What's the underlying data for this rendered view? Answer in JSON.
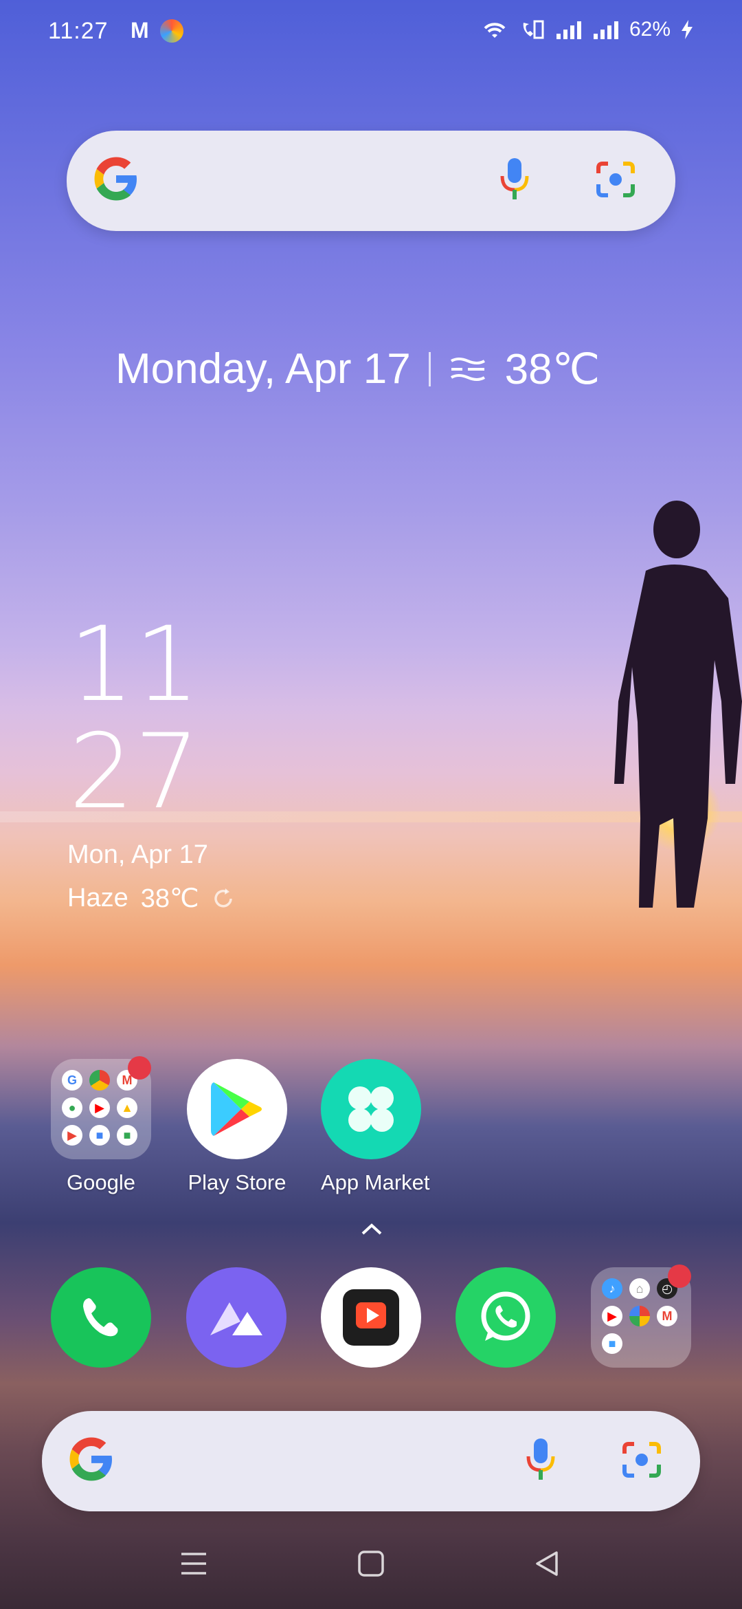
{
  "status_bar": {
    "time": "11:27",
    "battery": "62%",
    "icons": [
      "gmail-icon",
      "opera-icon",
      "wifi-icon",
      "volte-icon",
      "signal-icon",
      "signal-icon",
      "charging-icon"
    ]
  },
  "top_search": {
    "icons": [
      "google-logo",
      "microphone-icon",
      "lens-icon"
    ]
  },
  "date_widget": {
    "date": "Monday, Apr 17",
    "temp": "38℃",
    "weather_icon": "haze-icon"
  },
  "clock_widget": {
    "hour": "11",
    "minute": "27",
    "date": "Mon, Apr 17",
    "condition": "Haze",
    "temp": "38℃"
  },
  "apps": [
    {
      "label": "Google",
      "type": "folder"
    },
    {
      "label": "Play Store"
    },
    {
      "label": "App Market"
    }
  ],
  "dock": [
    "phone",
    "gallery",
    "video-player",
    "whatsapp",
    "folder"
  ],
  "bottom_search": {
    "icons": [
      "google-logo",
      "microphone-icon",
      "lens-icon"
    ]
  },
  "nav": [
    "menu",
    "home",
    "back"
  ],
  "colors": {
    "phone_green": "#18c45a",
    "gallery_purple": "#7b63f0",
    "whatsapp_green": "#25d366",
    "badge_red": "#e53946",
    "app_market_teal": "#14d9b3"
  }
}
